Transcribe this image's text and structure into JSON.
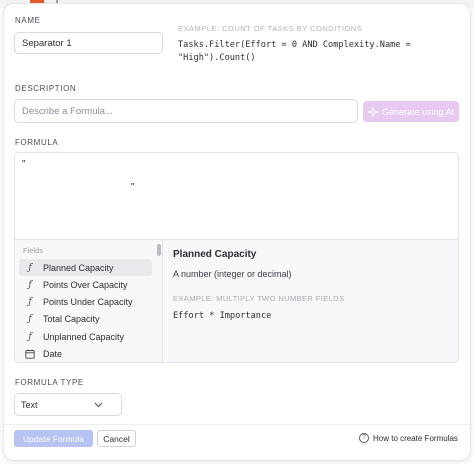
{
  "name": {
    "label": "NAME",
    "value": "Separator 1",
    "example_title": "EXAMPLE: COUNT OF TASKS BY CONDITIONS",
    "example_line1": "Tasks.Filter(Effort = 0 AND Complexity.Name =",
    "example_line2": "\"High\").Count()"
  },
  "description": {
    "label": "DESCRIPTION",
    "placeholder": "Describe a Formula...",
    "ai_button": "Generate using AI"
  },
  "formula": {
    "label": "FORMULA",
    "quote_open": "\"",
    "quote_close": "\""
  },
  "fields": {
    "header": "Fields",
    "items": [
      {
        "icon": "function-icon",
        "label": "Planned Capacity",
        "active": true
      },
      {
        "icon": "function-icon",
        "label": "Points Over Capacity"
      },
      {
        "icon": "function-icon",
        "label": "Points Under Capacity"
      },
      {
        "icon": "function-icon",
        "label": "Total Capacity"
      },
      {
        "icon": "function-icon",
        "label": "Unplanned Capacity"
      },
      {
        "icon": "calendar-icon",
        "label": "Date"
      }
    ],
    "detail": {
      "title": "Planned Capacity",
      "description": "A number (integer or decimal)",
      "example_title": "EXAMPLE: MULTIPLY TWO NUMBER FIELDS",
      "example": "Effort * Importance"
    }
  },
  "formula_type": {
    "label": "FORMULA TYPE",
    "value": "Text"
  },
  "footer": {
    "update_button": "Update Formula",
    "cancel_button": "Cancel",
    "help_link": "How to create Formulas"
  },
  "colors": {
    "ai_button_bg": "#e7c9f2",
    "primary_button_bg": "#b6c3f3",
    "brand_orange": "#e9582c"
  }
}
